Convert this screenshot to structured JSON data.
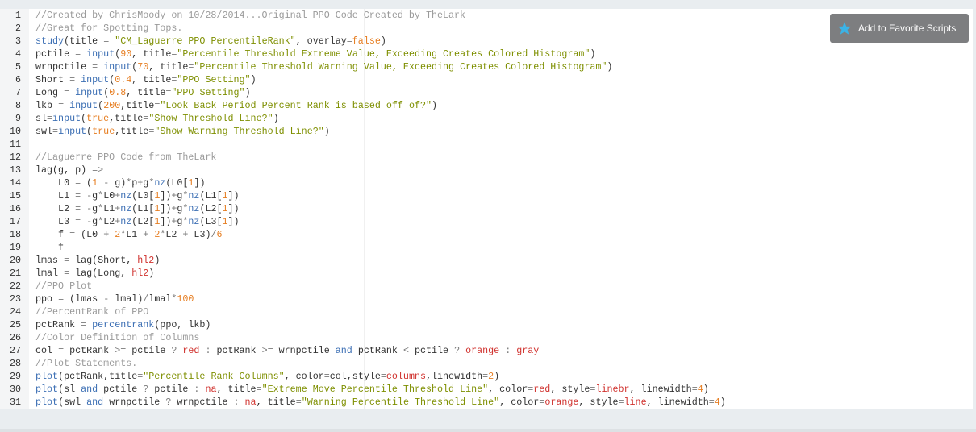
{
  "favorite_button": {
    "label": "Add to Favorite Scripts",
    "icon": "star-icon",
    "icon_color": "#3bb3e6"
  },
  "code_lines": [
    [
      [
        "c",
        "//Created by ChrisMoody on 10/28/2014...Original PPO Code Created by TheLark"
      ]
    ],
    [
      [
        "c",
        "//Great for Spotting Tops."
      ]
    ],
    [
      [
        "f",
        "study"
      ],
      [
        "i",
        "(title "
      ],
      [
        "o",
        "="
      ],
      [
        "i",
        " "
      ],
      [
        "s",
        "\"CM_Laguerre PPO PercentileRank\""
      ],
      [
        "i",
        ", overlay"
      ],
      [
        "o",
        "="
      ],
      [
        "n",
        "false"
      ],
      [
        "i",
        ")"
      ]
    ],
    [
      [
        "i",
        "pctile "
      ],
      [
        "o",
        "="
      ],
      [
        "i",
        " "
      ],
      [
        "f",
        "input"
      ],
      [
        "i",
        "("
      ],
      [
        "n",
        "90"
      ],
      [
        "i",
        ", title"
      ],
      [
        "o",
        "="
      ],
      [
        "s",
        "\"Percentile Threshold Extreme Value, Exceeding Creates Colored Histogram\""
      ],
      [
        "i",
        ")"
      ]
    ],
    [
      [
        "i",
        "wrnpctile "
      ],
      [
        "o",
        "="
      ],
      [
        "i",
        " "
      ],
      [
        "f",
        "input"
      ],
      [
        "i",
        "("
      ],
      [
        "n",
        "70"
      ],
      [
        "i",
        ", title"
      ],
      [
        "o",
        "="
      ],
      [
        "s",
        "\"Percentile Threshold Warning Value, Exceeding Creates Colored Histogram\""
      ],
      [
        "i",
        ")"
      ]
    ],
    [
      [
        "i",
        "Short "
      ],
      [
        "o",
        "="
      ],
      [
        "i",
        " "
      ],
      [
        "f",
        "input"
      ],
      [
        "i",
        "("
      ],
      [
        "n",
        "0.4"
      ],
      [
        "i",
        ", title"
      ],
      [
        "o",
        "="
      ],
      [
        "s",
        "\"PPO Setting\""
      ],
      [
        "i",
        ")"
      ]
    ],
    [
      [
        "i",
        "Long "
      ],
      [
        "o",
        "="
      ],
      [
        "i",
        " "
      ],
      [
        "f",
        "input"
      ],
      [
        "i",
        "("
      ],
      [
        "n",
        "0.8"
      ],
      [
        "i",
        ", title"
      ],
      [
        "o",
        "="
      ],
      [
        "s",
        "\"PPO Setting\""
      ],
      [
        "i",
        ")"
      ]
    ],
    [
      [
        "i",
        "lkb "
      ],
      [
        "o",
        "="
      ],
      [
        "i",
        " "
      ],
      [
        "f",
        "input"
      ],
      [
        "i",
        "("
      ],
      [
        "n",
        "200"
      ],
      [
        "i",
        ",title"
      ],
      [
        "o",
        "="
      ],
      [
        "s",
        "\"Look Back Period Percent Rank is based off of?\""
      ],
      [
        "i",
        ")"
      ]
    ],
    [
      [
        "i",
        "sl"
      ],
      [
        "o",
        "="
      ],
      [
        "f",
        "input"
      ],
      [
        "i",
        "("
      ],
      [
        "n",
        "true"
      ],
      [
        "i",
        ",title"
      ],
      [
        "o",
        "="
      ],
      [
        "s",
        "\"Show Threshold Line?\""
      ],
      [
        "i",
        ")"
      ]
    ],
    [
      [
        "i",
        "swl"
      ],
      [
        "o",
        "="
      ],
      [
        "f",
        "input"
      ],
      [
        "i",
        "("
      ],
      [
        "n",
        "true"
      ],
      [
        "i",
        ",title"
      ],
      [
        "o",
        "="
      ],
      [
        "s",
        "\"Show Warning Threshold Line?\""
      ],
      [
        "i",
        ")"
      ]
    ],
    [],
    [
      [
        "c",
        "//Laguerre PPO Code from TheLark"
      ]
    ],
    [
      [
        "i",
        "lag(g, p) "
      ],
      [
        "o",
        "=>"
      ]
    ],
    [
      [
        "i",
        "    L0 "
      ],
      [
        "o",
        "="
      ],
      [
        "i",
        " ("
      ],
      [
        "n",
        "1"
      ],
      [
        "i",
        " "
      ],
      [
        "o",
        "-"
      ],
      [
        "i",
        " g)"
      ],
      [
        "o",
        "*"
      ],
      [
        "i",
        "p"
      ],
      [
        "o",
        "+"
      ],
      [
        "i",
        "g"
      ],
      [
        "o",
        "*"
      ],
      [
        "f",
        "nz"
      ],
      [
        "i",
        "(L0["
      ],
      [
        "n",
        "1"
      ],
      [
        "i",
        "])"
      ]
    ],
    [
      [
        "i",
        "    L1 "
      ],
      [
        "o",
        "="
      ],
      [
        "i",
        " "
      ],
      [
        "o",
        "-"
      ],
      [
        "i",
        "g"
      ],
      [
        "o",
        "*"
      ],
      [
        "i",
        "L0"
      ],
      [
        "o",
        "+"
      ],
      [
        "f",
        "nz"
      ],
      [
        "i",
        "(L0["
      ],
      [
        "n",
        "1"
      ],
      [
        "i",
        "])"
      ],
      [
        "o",
        "+"
      ],
      [
        "i",
        "g"
      ],
      [
        "o",
        "*"
      ],
      [
        "f",
        "nz"
      ],
      [
        "i",
        "(L1["
      ],
      [
        "n",
        "1"
      ],
      [
        "i",
        "])"
      ]
    ],
    [
      [
        "i",
        "    L2 "
      ],
      [
        "o",
        "="
      ],
      [
        "i",
        " "
      ],
      [
        "o",
        "-"
      ],
      [
        "i",
        "g"
      ],
      [
        "o",
        "*"
      ],
      [
        "i",
        "L1"
      ],
      [
        "o",
        "+"
      ],
      [
        "f",
        "nz"
      ],
      [
        "i",
        "(L1["
      ],
      [
        "n",
        "1"
      ],
      [
        "i",
        "])"
      ],
      [
        "o",
        "+"
      ],
      [
        "i",
        "g"
      ],
      [
        "o",
        "*"
      ],
      [
        "f",
        "nz"
      ],
      [
        "i",
        "(L2["
      ],
      [
        "n",
        "1"
      ],
      [
        "i",
        "])"
      ]
    ],
    [
      [
        "i",
        "    L3 "
      ],
      [
        "o",
        "="
      ],
      [
        "i",
        " "
      ],
      [
        "o",
        "-"
      ],
      [
        "i",
        "g"
      ],
      [
        "o",
        "*"
      ],
      [
        "i",
        "L2"
      ],
      [
        "o",
        "+"
      ],
      [
        "f",
        "nz"
      ],
      [
        "i",
        "(L2["
      ],
      [
        "n",
        "1"
      ],
      [
        "i",
        "])"
      ],
      [
        "o",
        "+"
      ],
      [
        "i",
        "g"
      ],
      [
        "o",
        "*"
      ],
      [
        "f",
        "nz"
      ],
      [
        "i",
        "(L3["
      ],
      [
        "n",
        "1"
      ],
      [
        "i",
        "])"
      ]
    ],
    [
      [
        "i",
        "    f "
      ],
      [
        "o",
        "="
      ],
      [
        "i",
        " (L0 "
      ],
      [
        "o",
        "+"
      ],
      [
        "i",
        " "
      ],
      [
        "n",
        "2"
      ],
      [
        "o",
        "*"
      ],
      [
        "i",
        "L1 "
      ],
      [
        "o",
        "+"
      ],
      [
        "i",
        " "
      ],
      [
        "n",
        "2"
      ],
      [
        "o",
        "*"
      ],
      [
        "i",
        "L2 "
      ],
      [
        "o",
        "+"
      ],
      [
        "i",
        " L3)"
      ],
      [
        "o",
        "/"
      ],
      [
        "n",
        "6"
      ]
    ],
    [
      [
        "i",
        "    f"
      ]
    ],
    [
      [
        "i",
        "lmas "
      ],
      [
        "o",
        "="
      ],
      [
        "i",
        " lag(Short, "
      ],
      [
        "k",
        "hl2"
      ],
      [
        "i",
        ")"
      ]
    ],
    [
      [
        "i",
        "lmal "
      ],
      [
        "o",
        "="
      ],
      [
        "i",
        " lag(Long, "
      ],
      [
        "k",
        "hl2"
      ],
      [
        "i",
        ")"
      ]
    ],
    [
      [
        "c",
        "//PPO Plot"
      ]
    ],
    [
      [
        "i",
        "ppo "
      ],
      [
        "o",
        "="
      ],
      [
        "i",
        " (lmas "
      ],
      [
        "o",
        "-"
      ],
      [
        "i",
        " lmal)"
      ],
      [
        "o",
        "/"
      ],
      [
        "i",
        "lmal"
      ],
      [
        "o",
        "*"
      ],
      [
        "n",
        "100"
      ]
    ],
    [
      [
        "c",
        "//PercentRank of PPO"
      ]
    ],
    [
      [
        "i",
        "pctRank "
      ],
      [
        "o",
        "="
      ],
      [
        "i",
        " "
      ],
      [
        "f",
        "percentrank"
      ],
      [
        "i",
        "(ppo, lkb)"
      ]
    ],
    [
      [
        "c",
        "//Color Definition of Columns"
      ]
    ],
    [
      [
        "i",
        "col "
      ],
      [
        "o",
        "="
      ],
      [
        "i",
        " pctRank "
      ],
      [
        "o",
        ">="
      ],
      [
        "i",
        " pctile "
      ],
      [
        "o",
        "?"
      ],
      [
        "i",
        " "
      ],
      [
        "k",
        "red"
      ],
      [
        "i",
        " "
      ],
      [
        "o",
        ":"
      ],
      [
        "i",
        " pctRank "
      ],
      [
        "o",
        ">="
      ],
      [
        "i",
        " wrnpctile "
      ],
      [
        "f",
        "and"
      ],
      [
        "i",
        " pctRank "
      ],
      [
        "o",
        "<"
      ],
      [
        "i",
        " pctile "
      ],
      [
        "o",
        "?"
      ],
      [
        "i",
        " "
      ],
      [
        "k",
        "orange"
      ],
      [
        "i",
        " "
      ],
      [
        "o",
        ":"
      ],
      [
        "i",
        " "
      ],
      [
        "k",
        "gray"
      ]
    ],
    [
      [
        "c",
        "//Plot Statements."
      ]
    ],
    [
      [
        "f",
        "plot"
      ],
      [
        "i",
        "(pctRank,title"
      ],
      [
        "o",
        "="
      ],
      [
        "s",
        "\"Percentile Rank Columns\""
      ],
      [
        "i",
        ", color"
      ],
      [
        "o",
        "="
      ],
      [
        "i",
        "col,style"
      ],
      [
        "o",
        "="
      ],
      [
        "k",
        "columns"
      ],
      [
        "i",
        ",linewidth"
      ],
      [
        "o",
        "="
      ],
      [
        "n",
        "2"
      ],
      [
        "i",
        ")"
      ]
    ],
    [
      [
        "f",
        "plot"
      ],
      [
        "i",
        "(sl "
      ],
      [
        "f",
        "and"
      ],
      [
        "i",
        " pctile "
      ],
      [
        "o",
        "?"
      ],
      [
        "i",
        " pctile "
      ],
      [
        "o",
        ":"
      ],
      [
        "i",
        " "
      ],
      [
        "k",
        "na"
      ],
      [
        "i",
        ", title"
      ],
      [
        "o",
        "="
      ],
      [
        "s",
        "\"Extreme Move Percentile Threshold Line\""
      ],
      [
        "i",
        ", color"
      ],
      [
        "o",
        "="
      ],
      [
        "k",
        "red"
      ],
      [
        "i",
        ", style"
      ],
      [
        "o",
        "="
      ],
      [
        "k",
        "linebr"
      ],
      [
        "i",
        ", linewidth"
      ],
      [
        "o",
        "="
      ],
      [
        "n",
        "4"
      ],
      [
        "i",
        ")"
      ]
    ],
    [
      [
        "f",
        "plot"
      ],
      [
        "i",
        "(swl "
      ],
      [
        "f",
        "and"
      ],
      [
        "i",
        " wrnpctile "
      ],
      [
        "o",
        "?"
      ],
      [
        "i",
        " wrnpctile "
      ],
      [
        "o",
        ":"
      ],
      [
        "i",
        " "
      ],
      [
        "k",
        "na"
      ],
      [
        "i",
        ", title"
      ],
      [
        "o",
        "="
      ],
      [
        "s",
        "\"Warning Percentile Threshold Line\""
      ],
      [
        "i",
        ", color"
      ],
      [
        "o",
        "="
      ],
      [
        "k",
        "orange"
      ],
      [
        "i",
        ", style"
      ],
      [
        "o",
        "="
      ],
      [
        "k",
        "line"
      ],
      [
        "i",
        ", linewidth"
      ],
      [
        "o",
        "="
      ],
      [
        "n",
        "4"
      ],
      [
        "i",
        ")"
      ]
    ]
  ]
}
